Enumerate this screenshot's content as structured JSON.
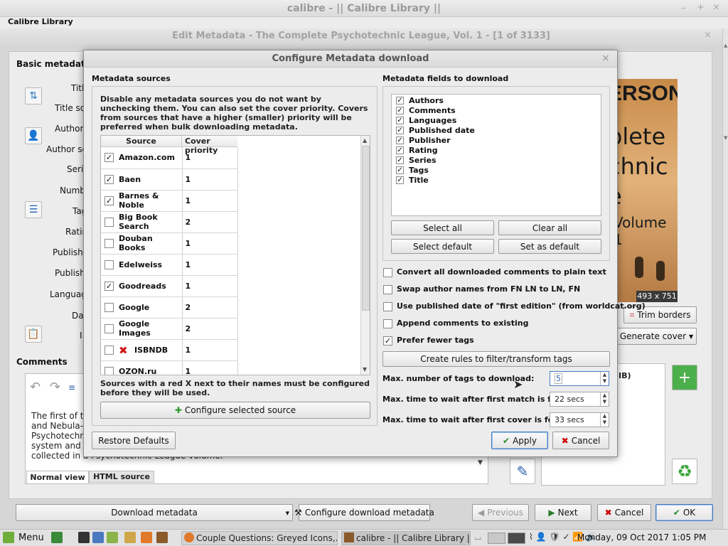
{
  "window": {
    "title": "calibre - || Calibre Library ||",
    "controls": [
      "–",
      "+",
      "×"
    ]
  },
  "menubar": {
    "library": "Calibre Library"
  },
  "edit_window": {
    "title": "Edit Metadata - The Complete Psychotechnic League, Vol. 1 -   [1 of 3133]",
    "basic_metadata": "Basic metadata",
    "side_labels": [
      "Titl",
      "Title so",
      "Author(",
      "Author so",
      "Serie",
      "Numb",
      "Tag",
      "Ratin",
      "Publishe",
      "Publish",
      "Languag",
      "Dat",
      "I"
    ],
    "comments_label": "Comments",
    "comment_lines": [
      "The first of th",
      "and Nebula-a",
      "Psychotechni",
      "system and b",
      "collected in a Psychotechnic League volume."
    ],
    "tab_normal": "Normal view",
    "tab_html": "HTML source",
    "cover_size": "493 x 751",
    "cover_text": [
      "ERSON",
      "plete",
      "chnic",
      "e",
      "Volume 1"
    ],
    "trim_borders": "Trim borders",
    "generate_cover": "Generate cover",
    "partial_ib": "IB)",
    "download_metadata": "Download metadata",
    "configure_download_metadata": "Configure download metadata",
    "previous": "Previous",
    "next": "Next",
    "cancel": "Cancel",
    "ok": "OK"
  },
  "dialog": {
    "title": "Configure Metadata download",
    "close": "×",
    "sources_heading": "Metadata sources",
    "sources_help": "Disable any metadata sources you do not want by unchecking them. You can also set the cover priority. Covers from sources that have a higher (smaller) priority will be preferred when bulk downloading metadata.",
    "col_source": "Source",
    "col_priority": "Cover priority",
    "sources": [
      {
        "name": "Amazon.com",
        "priority": "1",
        "checked": true,
        "red_x": false
      },
      {
        "name": "Baen",
        "priority": "1",
        "checked": true,
        "red_x": false
      },
      {
        "name": "Barnes & Noble",
        "priority": "1",
        "checked": true,
        "red_x": false
      },
      {
        "name": "Big Book Search",
        "priority": "2",
        "checked": false,
        "red_x": false
      },
      {
        "name": "Douban Books",
        "priority": "1",
        "checked": false,
        "red_x": false
      },
      {
        "name": "Edelweiss",
        "priority": "1",
        "checked": false,
        "red_x": false
      },
      {
        "name": "Goodreads",
        "priority": "1",
        "checked": true,
        "red_x": false
      },
      {
        "name": "Google",
        "priority": "2",
        "checked": false,
        "red_x": false
      },
      {
        "name": "Google Images",
        "priority": "2",
        "checked": false,
        "red_x": false
      },
      {
        "name": "ISBNDB",
        "priority": "1",
        "checked": false,
        "red_x": true
      },
      {
        "name": "OZON.ru",
        "priority": "1",
        "checked": false,
        "red_x": false
      }
    ],
    "red_x_note": "Sources with a red X next to their names must be configured before they will be used.",
    "configure_selected_source": "Configure selected source",
    "restore_defaults": "Restore Defaults",
    "fields_heading": "Metadata fields to download",
    "fields": [
      "Authors",
      "Comments",
      "Languages",
      "Published date",
      "Publisher",
      "Rating",
      "Series",
      "Tags",
      "Title"
    ],
    "select_all": "Select all",
    "clear_all": "Clear all",
    "select_default": "Select default",
    "set_as_default": "Set as default",
    "options": [
      {
        "label": "Convert all downloaded comments to plain text",
        "checked": false
      },
      {
        "label": "Swap author names from FN LN to LN, FN",
        "checked": false
      },
      {
        "label": "Use published date of \"first edition\" (from worldcat.org)",
        "checked": false
      },
      {
        "label": "Append comments to existing",
        "checked": false
      },
      {
        "label": "Prefer fewer tags",
        "checked": true
      }
    ],
    "create_rules": "Create rules to filter/transform tags",
    "max_tags_label": "Max. number of tags to download:",
    "max_tags_value": "5",
    "wait_match_label": "Max. time to wait after first match is found:",
    "wait_match_value": "22 secs",
    "wait_cover_label": "Max. time to wait after first cover is found:",
    "wait_cover_value": "33 secs",
    "apply": "Apply",
    "cancel": "Cancel"
  },
  "taskbar": {
    "menu": "Menu",
    "task1": "Couple Questions: Greyed Icons,...",
    "task2": "calibre - || Calibre Library ||",
    "clock": "Monday, 09 Oct 2017  1:05 PM"
  }
}
